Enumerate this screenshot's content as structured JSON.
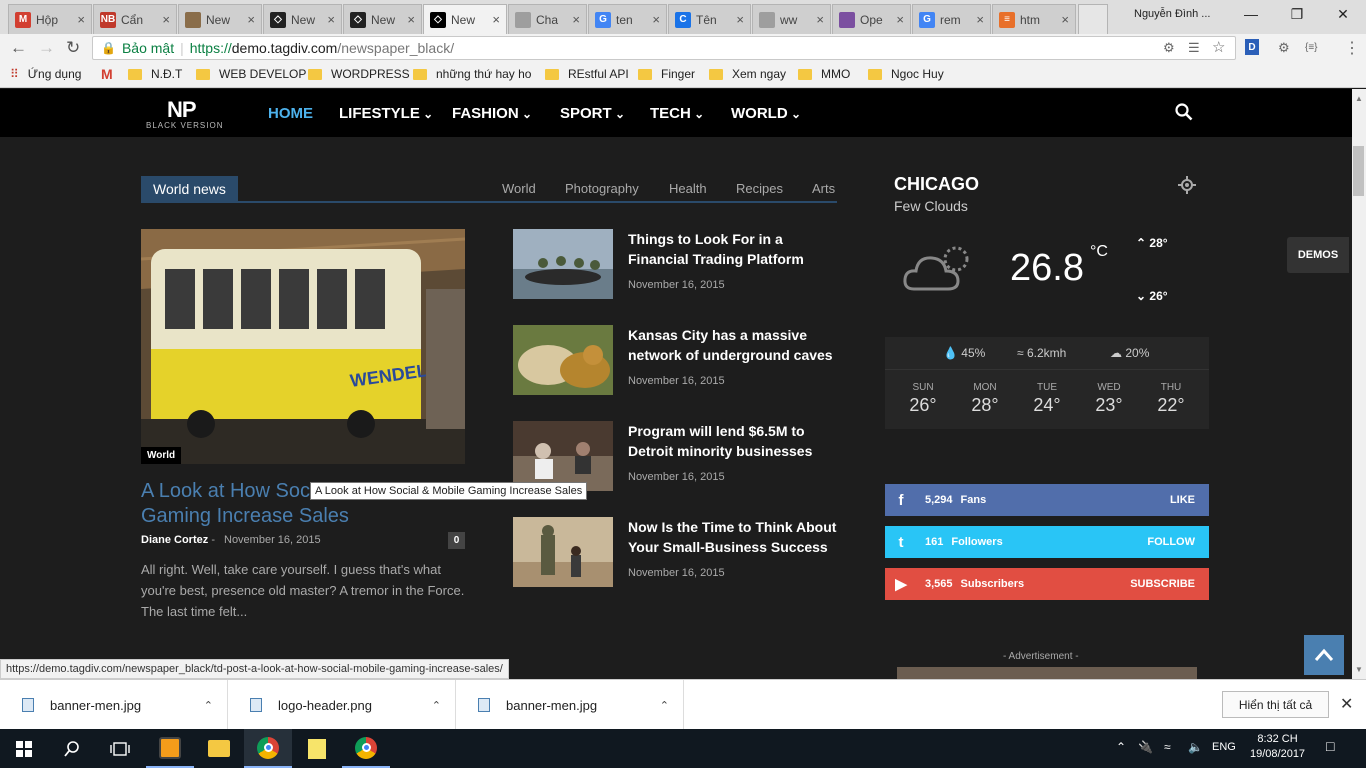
{
  "browser": {
    "tabs": [
      {
        "title": "Hộp",
        "favicon_color": "#d23f31",
        "favicon_text": "M"
      },
      {
        "title": "Cẩn",
        "favicon_color": "#c0392b",
        "favicon_text": "NB"
      },
      {
        "title": "New",
        "favicon_color": "#8a6d4a",
        "favicon_text": ""
      },
      {
        "title": "New",
        "favicon_color": "#222222",
        "favicon_text": "◇"
      },
      {
        "title": "New",
        "favicon_color": "#222222",
        "favicon_text": "◇"
      },
      {
        "title": "New",
        "favicon_color": "#000000",
        "favicon_text": "◇"
      },
      {
        "title": "Cha",
        "favicon_color": "#9e9e9e",
        "favicon_text": ""
      },
      {
        "title": "ten",
        "favicon_color": "#4285f4",
        "favicon_text": "G"
      },
      {
        "title": "Tên",
        "favicon_color": "#1a73e8",
        "favicon_text": "C"
      },
      {
        "title": "ww",
        "favicon_color": "#9e9e9e",
        "favicon_text": ""
      },
      {
        "title": "Ope",
        "favicon_color": "#7b4fa0",
        "favicon_text": ""
      },
      {
        "title": "rem",
        "favicon_color": "#4285f4",
        "favicon_text": "G"
      },
      {
        "title": "htm",
        "favicon_color": "#e8702a",
        "favicon_text": "≡"
      }
    ],
    "user": "Nguyễn Đình ...",
    "security_label": "Bảo mật",
    "url_protocol": "https://",
    "url_host": "demo.tagdiv.com",
    "url_path": "/newspaper_black/",
    "extension_label": "D",
    "bookmarks": [
      "Ứng dụng",
      "N.Đ.T",
      "WEB DEVELOP",
      "WORDPRESS",
      "những thứ hay ho",
      "REstful API",
      "Finger",
      "Xem ngay",
      "MMO",
      "Ngoc Huy"
    ]
  },
  "site": {
    "logo": "NP",
    "logo_sub": "BLACK VERSION",
    "menu": [
      "HOME",
      "LIFESTYLE",
      "FASHION",
      "SPORT",
      "TECH",
      "WORLD"
    ],
    "block_title": "World news",
    "subcats": [
      "World",
      "Photography",
      "Health",
      "Recipes",
      "Arts"
    ],
    "main": {
      "category": "World",
      "title": "A Look at How Social & Mobile Gaming Increase Sales",
      "tooltip": "A Look at How Social & Mobile Gaming Increase Sales",
      "author": "Diane Cortez",
      "separator": "-",
      "date": "November 16, 2015",
      "comments": "0",
      "excerpt": "All right. Well, take care yourself. I guess that's what you're best, presence old master? A tremor in the Force. The last time felt..."
    },
    "posts": [
      {
        "title": "Things to Look For in a Financial Trading Platform",
        "date": "November 16, 2015"
      },
      {
        "title": "Kansas City has a massive network of underground caves",
        "date": "November 16, 2015"
      },
      {
        "title": "Program will lend $6.5M to Detroit minority businesses",
        "date": "November 16, 2015"
      },
      {
        "title": "Now Is the Time to Think About Your Small-Business Success",
        "date": "November 16, 2015"
      }
    ],
    "weather": {
      "city": "CHICAGO",
      "description": "Few Clouds",
      "temp": "26.8",
      "unit": "°C",
      "high": "28°",
      "low": "26°",
      "humidity": "45%",
      "wind": "6.2kmh",
      "clouds": "20%",
      "forecast": [
        {
          "day": "SUN",
          "temp": "26°"
        },
        {
          "day": "MON",
          "temp": "28°"
        },
        {
          "day": "TUE",
          "temp": "24°"
        },
        {
          "day": "WED",
          "temp": "23°"
        },
        {
          "day": "THU",
          "temp": "22°"
        }
      ]
    },
    "social": [
      {
        "count": "5,294",
        "label": "Fans",
        "action": "LIKE",
        "color": "#516eab",
        "icon": "f"
      },
      {
        "count": "161",
        "label": "Followers",
        "action": "FOLLOW",
        "color": "#29c5f6",
        "icon": "t"
      },
      {
        "count": "3,565",
        "label": "Subscribers",
        "action": "SUBSCRIBE",
        "color": "#e14e42",
        "icon": "▶"
      }
    ],
    "demos": "DEMOS",
    "advertisement": "- Advertisement -"
  },
  "status_url": "https://demo.tagdiv.com/newspaper_black/td-post-a-look-at-how-social-mobile-gaming-increase-sales/",
  "downloads": [
    "banner-men.jpg",
    "logo-header.png",
    "banner-men.jpg"
  ],
  "show_all": "Hiển thị tất cả",
  "taskbar": {
    "lang": "ENG",
    "time": "8:32 CH",
    "date": "19/08/2017"
  }
}
